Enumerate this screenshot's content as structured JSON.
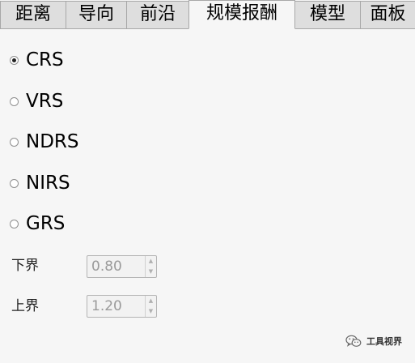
{
  "tabs": [
    {
      "label": "距离",
      "active": false
    },
    {
      "label": "导向",
      "active": false
    },
    {
      "label": "前沿",
      "active": false
    },
    {
      "label": "规模报酬",
      "active": true
    },
    {
      "label": "模型",
      "active": false
    },
    {
      "label": "面板",
      "active": false
    }
  ],
  "returns_to_scale": {
    "selected": "CRS",
    "options": [
      "CRS",
      "VRS",
      "NDRS",
      "NIRS",
      "GRS"
    ]
  },
  "bounds": {
    "lower_label": "下界",
    "lower_value": "0.80",
    "upper_label": "上界",
    "upper_value": "1.20"
  },
  "watermark": {
    "text": "工具视界",
    "icon": "wechat-icon"
  },
  "colors": {
    "background": "#f6f6f6",
    "tab_inactive": "#dedede",
    "disabled_text": "#9a9a9a"
  }
}
